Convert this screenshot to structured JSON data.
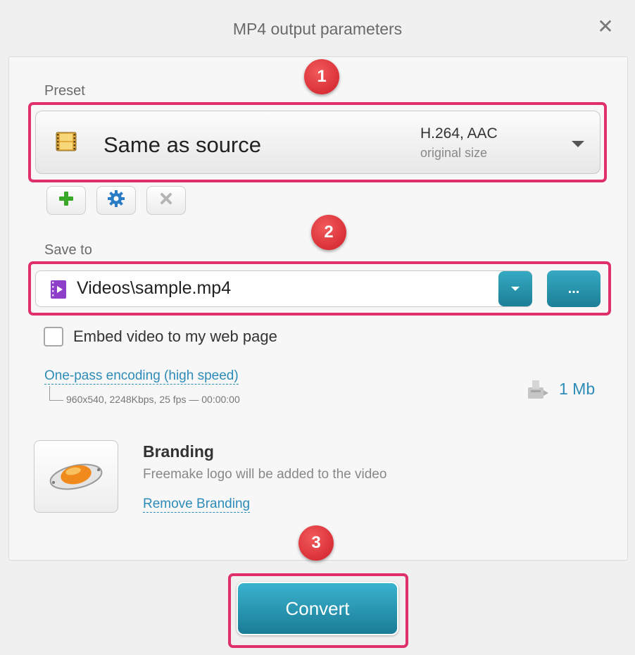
{
  "window": {
    "title": "MP4 output parameters"
  },
  "preset": {
    "label": "Preset",
    "name": "Same as source",
    "codec": "H.264, AAC",
    "size": "original size"
  },
  "save": {
    "label": "Save to",
    "path": "Videos\\sample.mp4",
    "browse_label": "..."
  },
  "embed": {
    "label": "Embed video to my web page",
    "checked": false
  },
  "encoding": {
    "link": "One-pass encoding (high speed)",
    "details": "960x540, 2248Kbps, 25 fps — 00:00:00"
  },
  "output_size": "1 Mb",
  "branding": {
    "title": "Branding",
    "description": "Freemake logo will be added to the video",
    "remove_link": "Remove Branding"
  },
  "convert_label": "Convert",
  "callouts": [
    "1",
    "2",
    "3"
  ],
  "colors": {
    "accent": "#1f8aa6",
    "highlight": "#e0306a",
    "callout": "#d9232e",
    "link": "#2d8bb8"
  },
  "icons": {
    "preset": "film-icon",
    "add": "plus-icon",
    "edit": "gear-icon",
    "delete": "x-icon",
    "file": "video-file-icon",
    "size": "disk-icon",
    "brand": "freemake-logo"
  }
}
